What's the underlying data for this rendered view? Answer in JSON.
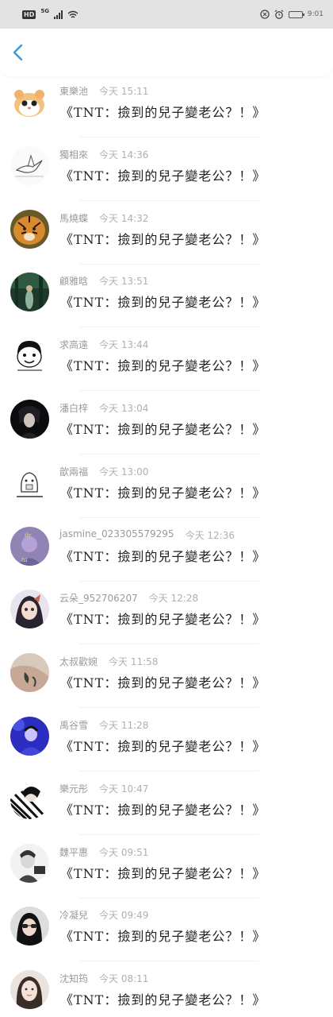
{
  "status_bar": {
    "hd": "HD",
    "network": "5G",
    "clock": "9:01"
  },
  "colors": {
    "accent": "#3a9bd9",
    "status_bg": "#e3e3e3"
  },
  "back_icon": "chevron-left-icon",
  "items": [
    {
      "name": "東樂池",
      "time": "今天 15:11",
      "title": "《TNT：撿到的兒子變老公？！》",
      "avatar": "hamster"
    },
    {
      "name": "獨相來",
      "time": "今天 14:36",
      "title": "《TNT：撿到的兒子變老公？！》",
      "avatar": "bird-sketch"
    },
    {
      "name": "馬燒蝶",
      "time": "今天 14:32",
      "title": "《TNT：撿到的兒子變老公？！》",
      "avatar": "tiger"
    },
    {
      "name": "顧雅晗",
      "time": "今天 13:51",
      "title": "《TNT：撿到的兒子變老公？！》",
      "avatar": "forest"
    },
    {
      "name": "求高遠",
      "time": "今天 13:44",
      "title": "《TNT：撿到的兒子變老公？！》",
      "avatar": "meme"
    },
    {
      "name": "潘白梓",
      "time": "今天 13:04",
      "title": "《TNT：撿到的兒子變老公？！》",
      "avatar": "dark-portrait"
    },
    {
      "name": "歆兩福",
      "time": "今天 13:00",
      "title": "《TNT：撿到的兒子變老公？！》",
      "avatar": "phone-cartoon"
    },
    {
      "name": "jasmine_023305579295",
      "time": "今天 12:36",
      "title": "《TNT：撿到的兒子變老公？！》",
      "avatar": "purple-art"
    },
    {
      "name": "云朵_952706207",
      "time": "今天 12:28",
      "title": "《TNT：撿到的兒子變老公？！》",
      "avatar": "anime-girl"
    },
    {
      "name": "太叔歡婉",
      "time": "今天 11:58",
      "title": "《TNT：撿到的兒子變老公？！》",
      "avatar": "tattoo-arm"
    },
    {
      "name": "禹谷雪",
      "time": "今天 11:28",
      "title": "《TNT：撿到的兒子變老公？！》",
      "avatar": "blue-girl"
    },
    {
      "name": "樂元彤",
      "time": "今天 10:47",
      "title": "《TNT：撿到的兒子變老公？！》",
      "avatar": "stripes"
    },
    {
      "name": "魏平惠",
      "time": "今天 09:51",
      "title": "《TNT：撿到的兒子變老公？！》",
      "avatar": "bw-portrait"
    },
    {
      "name": "冷凝兒",
      "time": "今天 09:49",
      "title": "《TNT：撿到的兒子變老公？！》",
      "avatar": "sunglasses-girl"
    },
    {
      "name": "沈知筠",
      "time": "今天 08:11",
      "title": "《TNT：撿到的兒子變老公？！》",
      "avatar": "girl-portrait"
    }
  ]
}
